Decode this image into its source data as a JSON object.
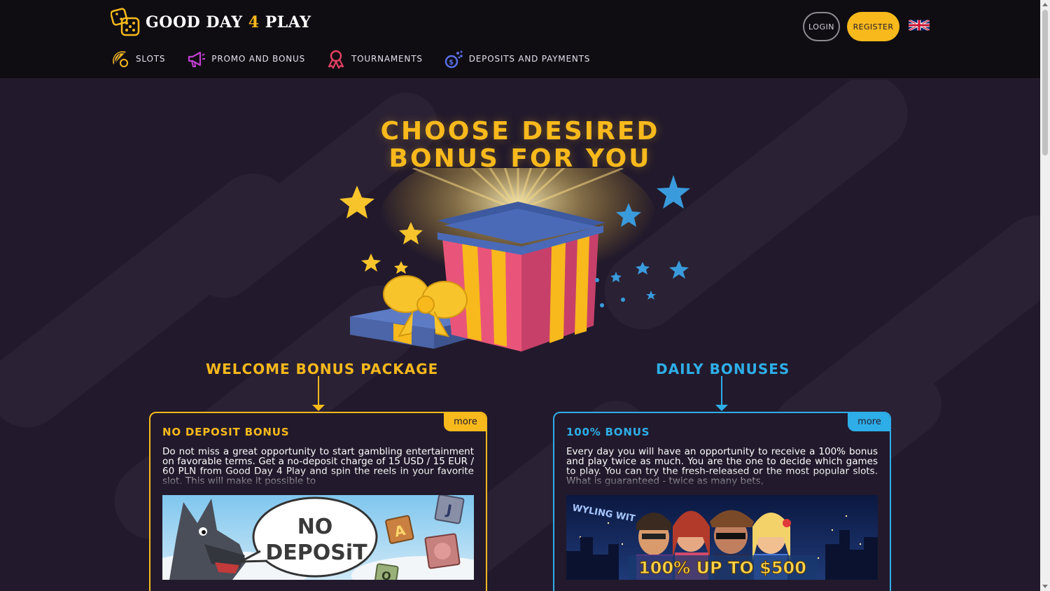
{
  "header": {
    "logo_text_1": "GOOD DAY ",
    "logo_text_2": "4",
    "logo_text_3": " PLAY",
    "login_label": "LOGIN",
    "register_label": "REGISTER",
    "language_icon": "uk-flag-icon"
  },
  "nav": {
    "items": [
      {
        "label": "SLOTS",
        "icon": "lemon-icon"
      },
      {
        "label": "PROMO AND BONUS",
        "icon": "megaphone-icon"
      },
      {
        "label": "TOURNAMENTS",
        "icon": "ribbon-icon"
      },
      {
        "label": "DEPOSITS AND PAYMENTS",
        "icon": "coins-icon"
      }
    ]
  },
  "hero": {
    "title_line1": "CHOOSE DESIRED",
    "title_line2": "BONUS FOR YOU"
  },
  "sections": {
    "welcome": {
      "title": "WELCOME BONUS PACKAGE",
      "card": {
        "more": "more",
        "title": "NO DEPOSIT BONUS",
        "text": "Do not miss a great opportunity to start gambling entertainment on favorable terms. Get a no-deposit charge of 15 USD / 15 EUR / 60 PLN from Good Day 4 Play and spin the reels in your favorite slot. This will make it possible to",
        "banner_text_1": "NO",
        "banner_text_2": "DEPOSiT",
        "banner_tiles": [
          "A",
          "J",
          "Q"
        ]
      }
    },
    "daily": {
      "title": "DAILY BONUSES",
      "card": {
        "more": "more",
        "title": "100% BONUS",
        "text": "Every day you will have an opportunity to receive a 100% bonus and play twice as much. You are the one to decide which games to play. You can try the fresh-released or the most popular slots. What is guaranteed - twice as many bets,",
        "banner_sign": "WYLING WIT",
        "banner_text": "100% UP TO $500"
      }
    }
  },
  "colors": {
    "accent_yellow": "#f8b91c",
    "accent_blue": "#2eaee8",
    "background": "#221a2c",
    "header_bg": "#0f0d12"
  }
}
